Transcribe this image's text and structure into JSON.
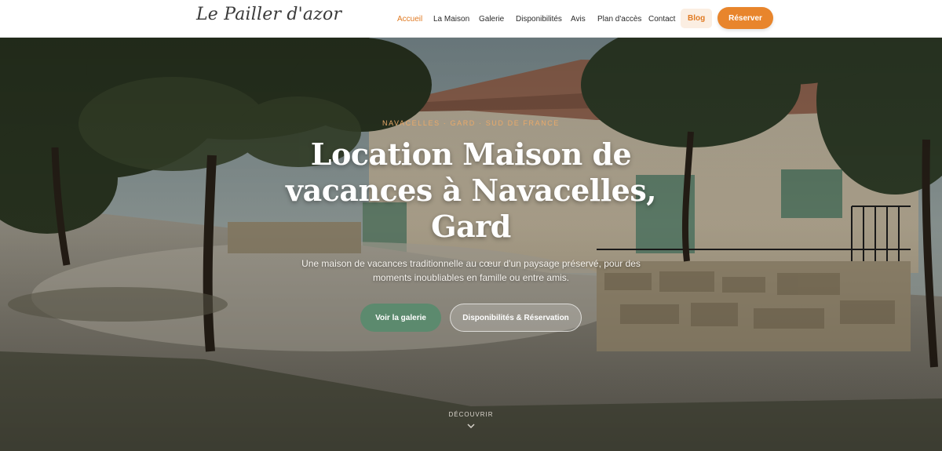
{
  "brand": {
    "logo_text": "Le Pailler d'azor"
  },
  "nav": {
    "items": [
      {
        "label": "Accueil",
        "active": true
      },
      {
        "label": "La Maison"
      },
      {
        "label": "Galerie"
      },
      {
        "label": "Disponibilités"
      },
      {
        "label": "Avis"
      },
      {
        "label": "Plan d'accès"
      },
      {
        "label": "Contact"
      },
      {
        "label": "Blog",
        "highlighted": true
      }
    ],
    "cta_label": "Réserver"
  },
  "hero": {
    "eyebrow": "NAVACELLES · GARD · SUD DE FRANCE",
    "title": "Location Maison de vacances à Navacelles, Gard",
    "subtitle": "Une maison de vacances traditionnelle au cœur d'un paysage préservé, pour des moments inoubliables en famille ou entre amis.",
    "primary_button": "Voir la galerie",
    "secondary_button": "Disponibilités & Réservation",
    "scroll_label": "DÉCOUVRIR",
    "scroll_icon": "chevron-down-icon"
  },
  "colors": {
    "accent": "#e8852c",
    "accent_text": "#e07a22",
    "green_button": "#5c8a6e",
    "eyebrow": "#e9a96a"
  }
}
